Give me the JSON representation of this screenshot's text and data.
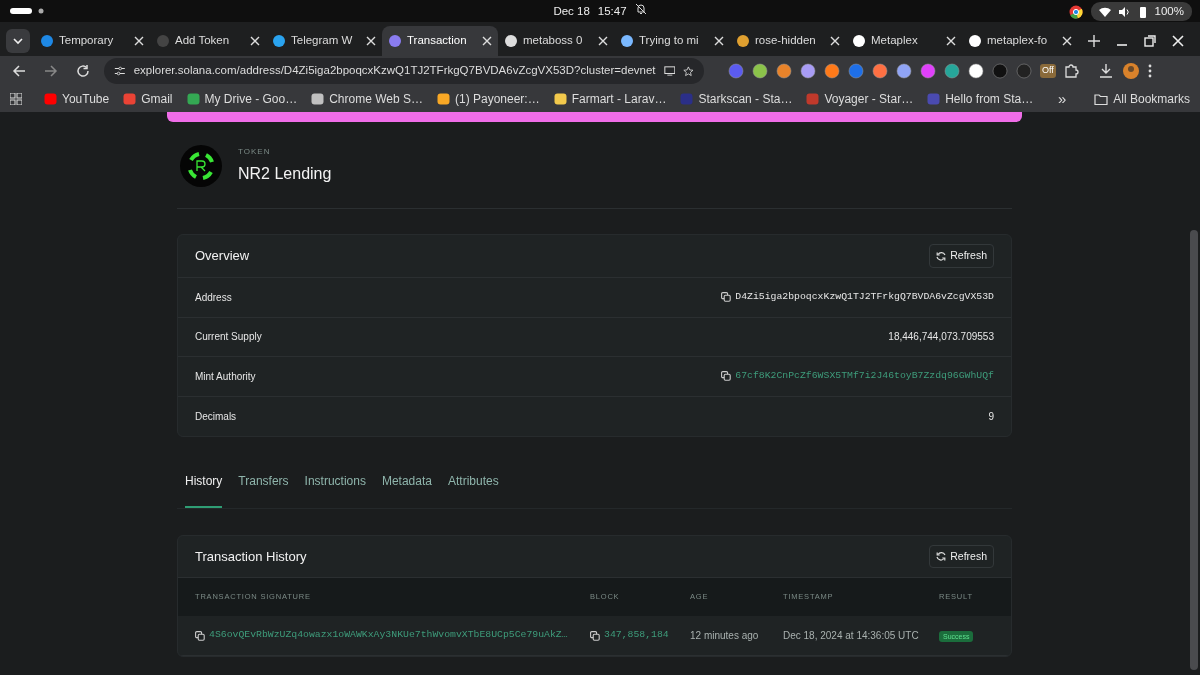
{
  "system_bar": {
    "date": "Dec 18",
    "time": "15:47",
    "battery": "100%"
  },
  "browser_tabs": [
    {
      "title": "Temporary",
      "selected": false
    },
    {
      "title": "Add Token",
      "selected": false
    },
    {
      "title": "Telegram W",
      "selected": false
    },
    {
      "title": "Transaction",
      "selected": true
    },
    {
      "title": "metaboss 0",
      "selected": false
    },
    {
      "title": "Trying to mi",
      "selected": false
    },
    {
      "title": "rose-hidden",
      "selected": false
    },
    {
      "title": "Metaplex",
      "selected": false
    },
    {
      "title": "metaplex-fo",
      "selected": false
    }
  ],
  "address_bar": {
    "url": "explorer.solana.com/address/D4Zi5iga2bpoqcxKzwQ1TJ2TFrkgQ7BVDA6vZcgVX53D?cluster=devnet"
  },
  "extension_badge": "Off",
  "bookmarks": [
    {
      "label": "YouTube"
    },
    {
      "label": "Gmail"
    },
    {
      "label": "My Drive - Goo…"
    },
    {
      "label": "Chrome Web S…"
    },
    {
      "label": "(1) Payoneer:…"
    },
    {
      "label": "Farmart - Larav…"
    },
    {
      "label": "Starkscan - Sta…"
    },
    {
      "label": "Voyager - Star…"
    },
    {
      "label": "Hello from Sta…"
    }
  ],
  "bookmarks_overflow": "»",
  "all_bookmarks": "All Bookmarks",
  "token": {
    "eyebrow": "TOKEN",
    "name": "NR2 Lending"
  },
  "overview": {
    "title": "Overview",
    "refresh": "Refresh",
    "rows": [
      {
        "label": "Address",
        "value": "D4Zi5iga2bpoqcxKzwQ1TJ2TFrkgQ7BVDA6vZcgVX53D",
        "kind": "address"
      },
      {
        "label": "Current Supply",
        "value": "18,446,744,073.709553",
        "kind": "text"
      },
      {
        "label": "Mint Authority",
        "value": "67cf8K2CnPcZf6WSX5TMf7i2J46toyB7Zzdq96GWhUQf",
        "kind": "link"
      },
      {
        "label": "Decimals",
        "value": "9",
        "kind": "text"
      }
    ]
  },
  "page_tabs": [
    {
      "label": "History",
      "selected": true
    },
    {
      "label": "Transfers",
      "selected": false
    },
    {
      "label": "Instructions",
      "selected": false
    },
    {
      "label": "Metadata",
      "selected": false
    },
    {
      "label": "Attributes",
      "selected": false
    }
  ],
  "history": {
    "title": "Transaction History",
    "refresh": "Refresh",
    "columns": [
      "TRANSACTION SIGNATURE",
      "BLOCK",
      "AGE",
      "TIMESTAMP",
      "RESULT"
    ],
    "rows": [
      {
        "signature": "4S6ovQEvRbWzUZq4owazx1oWAWKxAy3NKUe7thWvomvXTbE8UCp5Ce79uAkZ…",
        "block": "347,858,184",
        "age": "12 minutes ago",
        "timestamp": "Dec 18, 2024 at 14:36:05 UTC",
        "result": "Success"
      }
    ]
  }
}
